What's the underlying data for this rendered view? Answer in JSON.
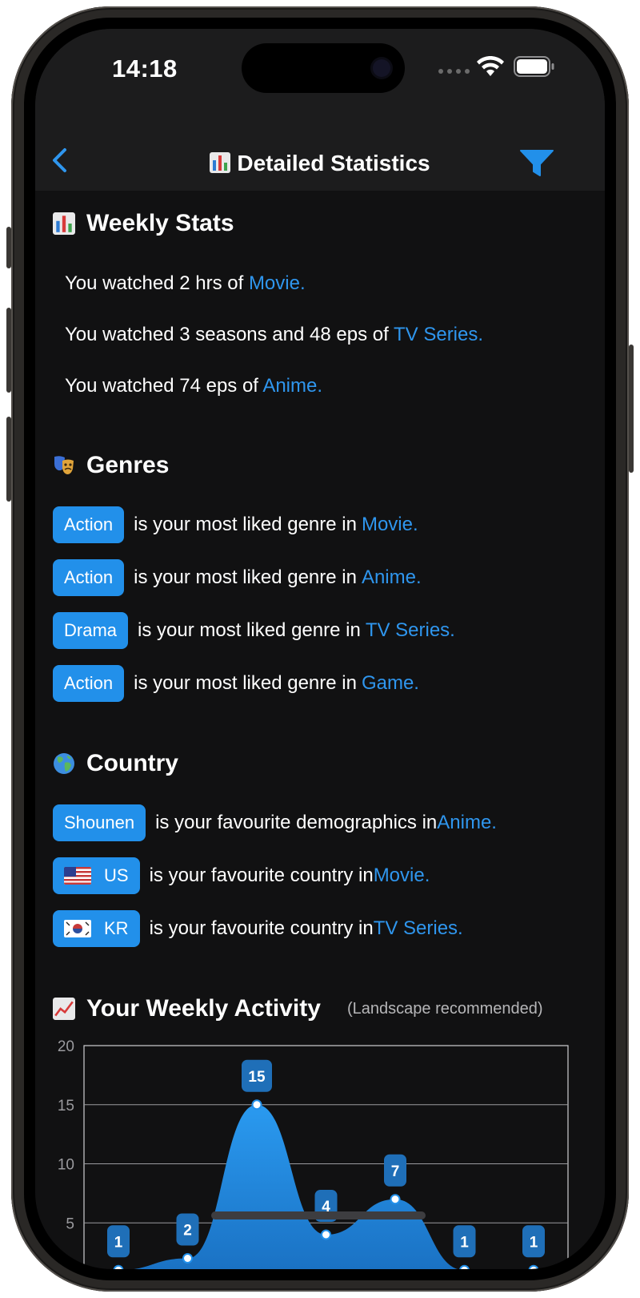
{
  "status_bar": {
    "time": "14:18"
  },
  "nav": {
    "title": "Detailed Statistics",
    "title_icon": "bar-chart-emoji",
    "back_icon": "chevron-left-icon",
    "filter_icon": "filter-icon"
  },
  "weekly_stats": {
    "title": "Weekly Stats",
    "lines": [
      {
        "text": "You watched 2 hrs of ",
        "link": "Movie."
      },
      {
        "text": "You watched 3 seasons and 48 eps of ",
        "link": "TV Series."
      },
      {
        "text": "You watched 74 eps of ",
        "link": "Anime."
      }
    ]
  },
  "genres": {
    "title": "Genres",
    "rows": [
      {
        "tag": "Action",
        "text": "is your most liked genre in ",
        "link": "Movie."
      },
      {
        "tag": "Action",
        "text": "is your most liked genre in ",
        "link": "Anime."
      },
      {
        "tag": "Drama",
        "text": "is your most liked genre in ",
        "link": "TV Series."
      },
      {
        "tag": "Action",
        "text": "is your most liked genre in ",
        "link": "Game."
      }
    ]
  },
  "country": {
    "title": "Country",
    "rows": [
      {
        "tag": "Shounen",
        "text": "is your favourite demographics in ",
        "link": "Anime."
      },
      {
        "tag": "US",
        "flag": "us-flag",
        "text": "is your favourite country in ",
        "link": "Movie."
      },
      {
        "tag": "KR",
        "flag": "kr-flag",
        "text": "is your favourite country in ",
        "link": "TV Series."
      }
    ]
  },
  "activity": {
    "title": "Your Weekly Activity",
    "note": "(Landscape recommended)"
  },
  "colors": {
    "accent": "#2290ea",
    "link": "#2f96ee",
    "background": "#111112",
    "bar": "#1c1c1d"
  },
  "chart_data": {
    "type": "area",
    "title": "Your Weekly Activity",
    "x": [
      1,
      2,
      3,
      4,
      5,
      6,
      7
    ],
    "values": [
      1,
      2,
      15,
      4,
      7,
      1,
      1
    ],
    "data_labels": [
      "1",
      "2",
      "15",
      "4",
      "7",
      "1",
      "1"
    ],
    "y_ticks": [
      "20",
      "15",
      "10",
      "5"
    ],
    "ylim": [
      0,
      20
    ],
    "grid": true
  }
}
